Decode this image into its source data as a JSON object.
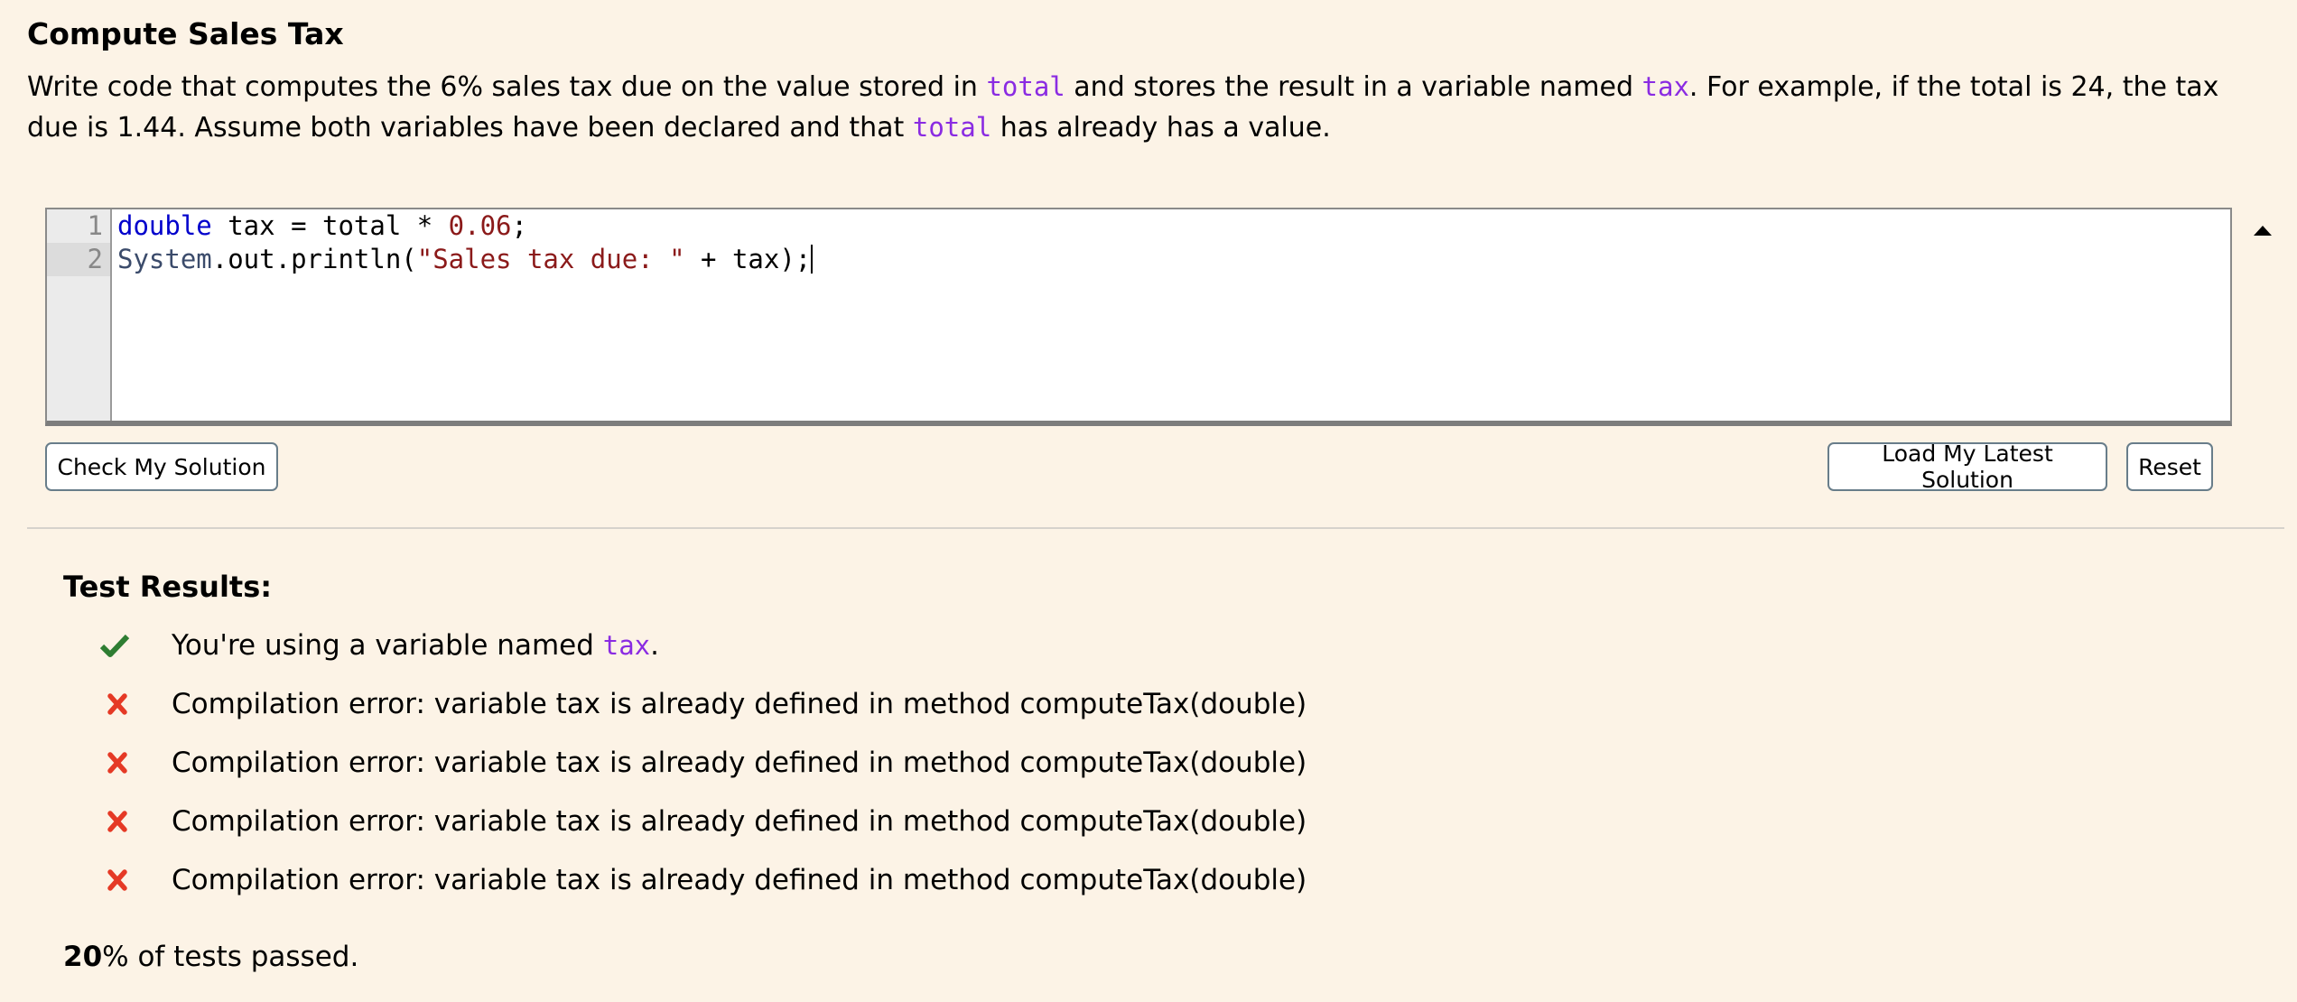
{
  "problem": {
    "title": "Compute Sales Tax",
    "description": {
      "part1": "Write code that computes the 6% sales tax due on the value stored in ",
      "code1": "total",
      "part2": " and stores the result in a variable named ",
      "code2": "tax",
      "part3": ". For example, if the total is 24, the tax due is 1.44. Assume both variables have been declared and that ",
      "code3": "total",
      "part4": " has already has a value."
    }
  },
  "editor": {
    "line_numbers": [
      "1",
      "2"
    ],
    "active_line": 2,
    "lines": [
      {
        "tokens": [
          {
            "t": "double",
            "c": "kw"
          },
          {
            "t": " tax = total * ",
            "c": ""
          },
          {
            "t": "0.06",
            "c": "num"
          },
          {
            "t": ";",
            "c": ""
          }
        ]
      },
      {
        "tokens": [
          {
            "t": "System",
            "c": "cls"
          },
          {
            "t": ".out.println(",
            "c": ""
          },
          {
            "t": "\"Sales tax due: \"",
            "c": "str"
          },
          {
            "t": " + tax);",
            "c": ""
          }
        ]
      }
    ],
    "collapse_icon": "triangle-up"
  },
  "buttons": {
    "check": "Check My Solution",
    "load": "Load My Latest Solution",
    "reset": "Reset"
  },
  "results": {
    "title": "Test Results:",
    "items": [
      {
        "status": "pass",
        "icon": "checkmark",
        "text": "You're using a variable named ",
        "code": "tax",
        "suffix": "."
      },
      {
        "status": "fail",
        "icon": "x-mark",
        "text": "Compilation error: variable tax is already defined in method computeTax(double)",
        "code": "",
        "suffix": ""
      },
      {
        "status": "fail",
        "icon": "x-mark",
        "text": "Compilation error: variable tax is already defined in method computeTax(double)",
        "code": "",
        "suffix": ""
      },
      {
        "status": "fail",
        "icon": "x-mark",
        "text": "Compilation error: variable tax is already defined in method computeTax(double)",
        "code": "",
        "suffix": ""
      },
      {
        "status": "fail",
        "icon": "x-mark",
        "text": "Compilation error: variable tax is already defined in method computeTax(double)",
        "code": "",
        "suffix": ""
      }
    ],
    "summary_percent": "20",
    "summary_text": "% of tests passed."
  },
  "colors": {
    "background": "#fcf3e6",
    "pass": "#2e7d32",
    "fail": "#e53925",
    "code_ref": "#8a2be2"
  }
}
